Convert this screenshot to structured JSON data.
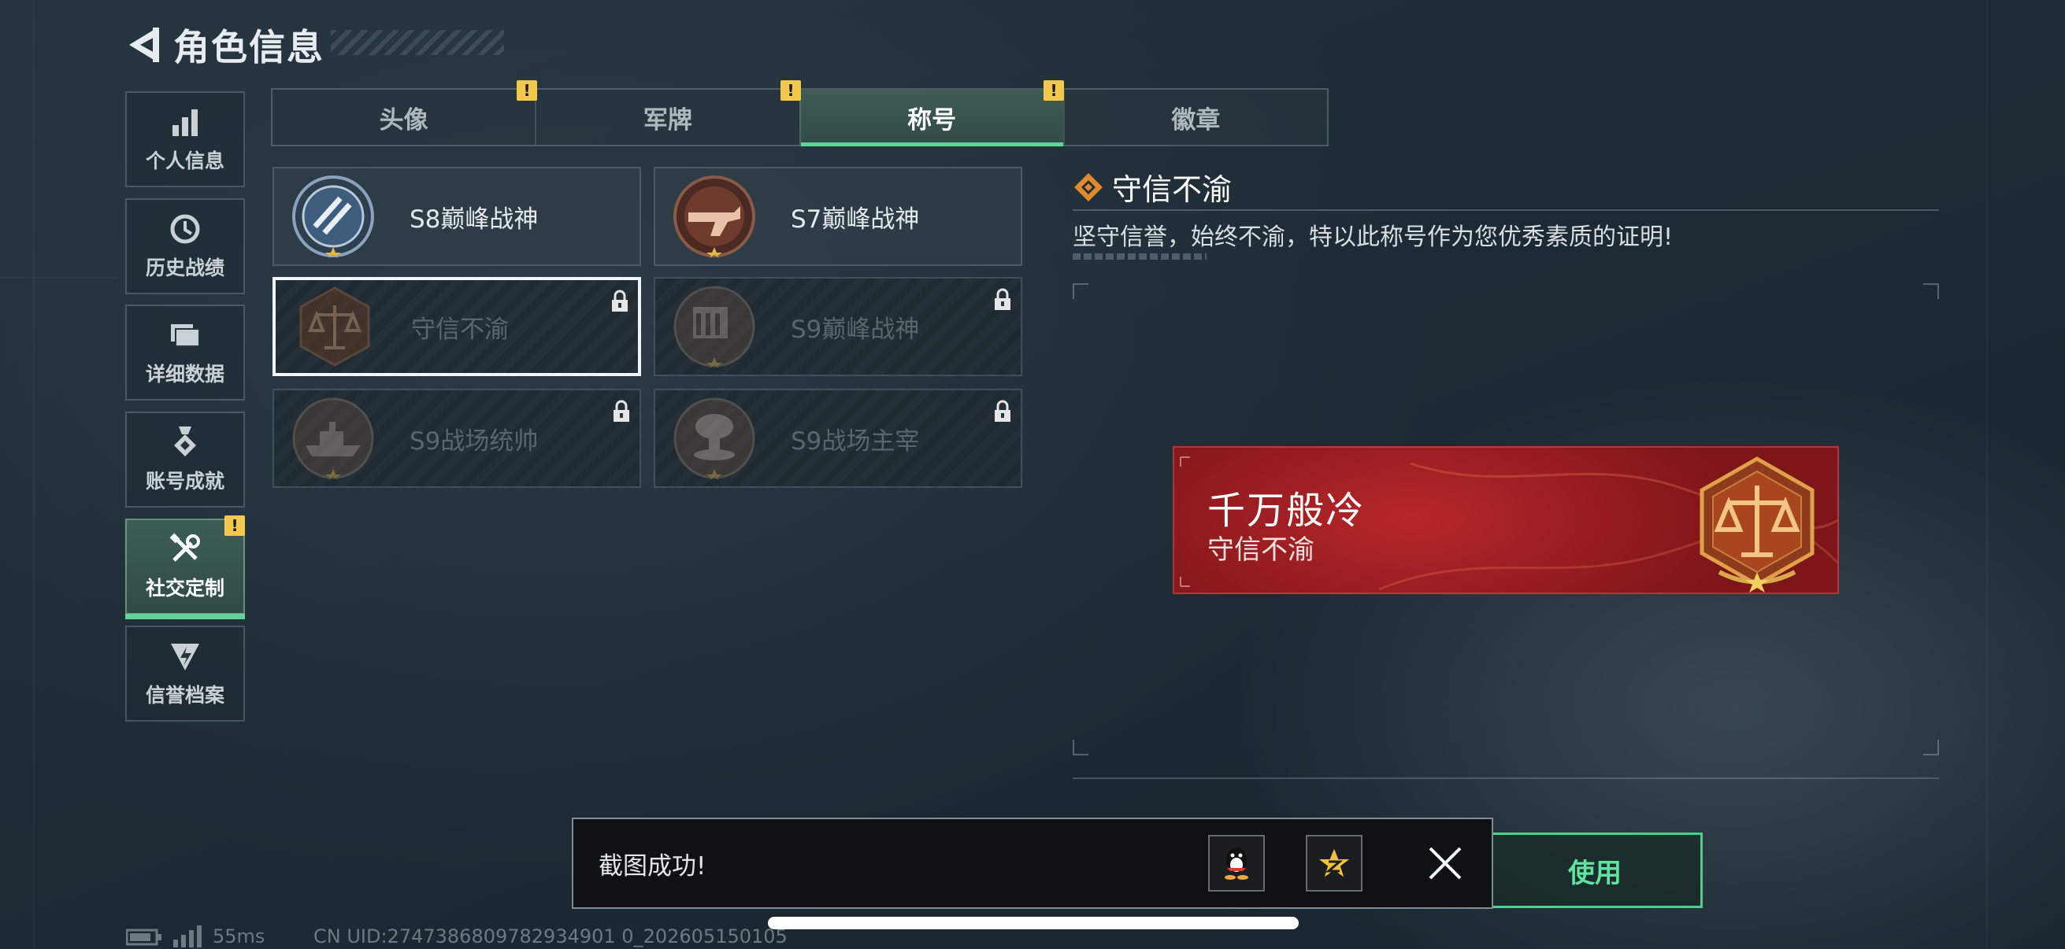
{
  "header": {
    "title": "角色信息",
    "back_icon": "back-arrow-icon"
  },
  "sidebar": {
    "items": [
      {
        "label": "个人信息",
        "icon": "bar-chart-icon",
        "active": false,
        "warning": false
      },
      {
        "label": "历史战绩",
        "icon": "history-clock-icon",
        "active": false,
        "warning": false
      },
      {
        "label": "详细数据",
        "icon": "folder-icon",
        "active": false,
        "warning": false
      },
      {
        "label": "账号成就",
        "icon": "achievement-medal-icon",
        "active": false,
        "warning": false
      },
      {
        "label": "社交定制",
        "icon": "tools-icon",
        "active": true,
        "warning": true
      },
      {
        "label": "信誉档案",
        "icon": "credit-shield-icon",
        "active": false,
        "warning": false
      }
    ],
    "warning_mark": "!"
  },
  "tabs": [
    {
      "label": "头像",
      "active": false,
      "warning": true
    },
    {
      "label": "军牌",
      "active": false,
      "warning": true
    },
    {
      "label": "称号",
      "active": true,
      "warning": true
    },
    {
      "label": "徽章",
      "active": false,
      "warning": false
    }
  ],
  "titles": [
    {
      "label": "S8巅峰战神",
      "locked": false,
      "selected": false,
      "medal": "s8-peak-medal-icon"
    },
    {
      "label": "S7巅峰战神",
      "locked": false,
      "selected": false,
      "medal": "s7-peak-medal-icon"
    },
    {
      "label": "守信不渝",
      "locked": true,
      "selected": true,
      "medal": "scales-medal-icon"
    },
    {
      "label": "S9巅峰战神",
      "locked": true,
      "selected": false,
      "medal": "s9-peak-medal-icon"
    },
    {
      "label": "S9战场统帅",
      "locked": true,
      "selected": false,
      "medal": "warship-medal-icon"
    },
    {
      "label": "S9战场主宰",
      "locked": true,
      "selected": false,
      "medal": "mushroom-cloud-medal-icon"
    }
  ],
  "detail": {
    "title": "守信不渝",
    "description": "坚守信誉，始终不渝，特以此称号作为您优秀素质的证明!",
    "banner": {
      "name": "千万般冷",
      "title": "守信不渝",
      "emblem": "scales-emblem-icon"
    }
  },
  "use_button": {
    "label": "使用"
  },
  "toast": {
    "message": "截图成功!",
    "buttons": [
      "qq-share-icon",
      "star-share-icon",
      "close-icon"
    ]
  },
  "status": {
    "ping": "55ms",
    "uid": "CN UID:2747386809782934901 0_202605150105"
  },
  "colors": {
    "accent_green": "#5fd59a",
    "warning_yellow": "#f2c94c",
    "banner_red": "#b7272a"
  }
}
